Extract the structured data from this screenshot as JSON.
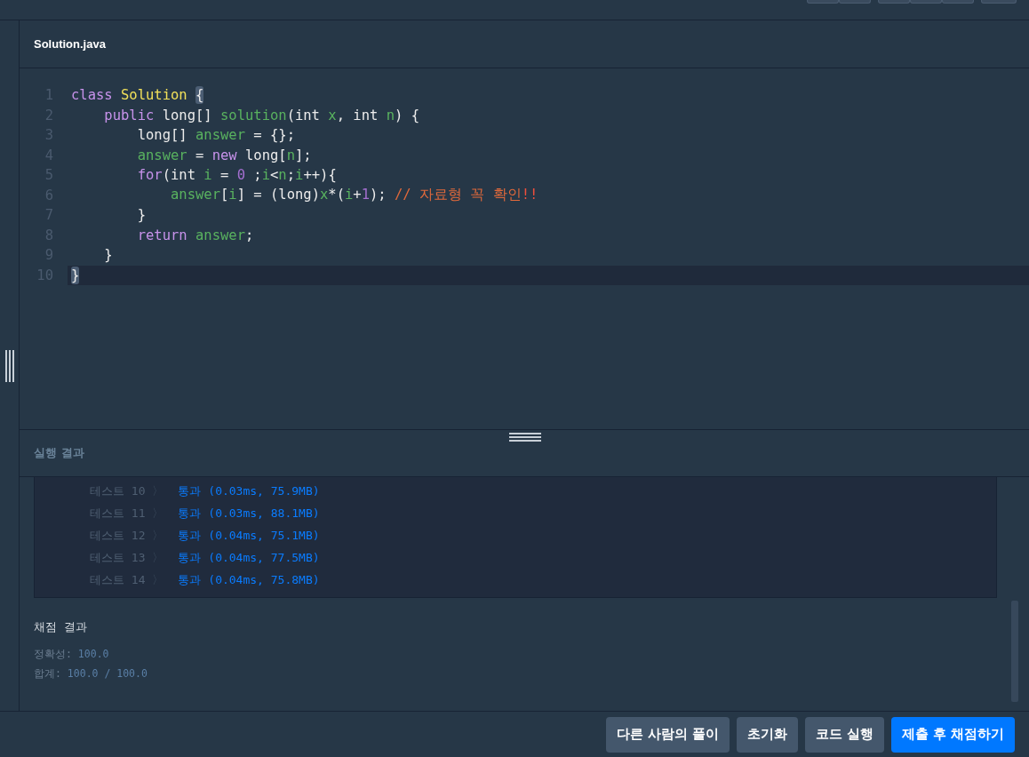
{
  "file_tab": {
    "title": "Solution.java"
  },
  "editor": {
    "lines": [
      {
        "number": "1",
        "current": false,
        "tokens": [
          {
            "t": "class ",
            "kind": "keyword"
          },
          {
            "t": "Solution ",
            "kind": "class"
          },
          {
            "t": "{",
            "kind": "match"
          }
        ],
        "children": [
          {
            "number": "2",
            "current": false,
            "tokens": [
              {
                "t": "public ",
                "kind": "keyword"
              },
              {
                "t": "long[] ",
                "kind": "plain"
              },
              {
                "t": "solution",
                "kind": "ident"
              },
              {
                "t": "(int ",
                "kind": "plain"
              },
              {
                "t": "x",
                "kind": "ident"
              },
              {
                "t": ", int ",
                "kind": "plain"
              },
              {
                "t": "n",
                "kind": "ident"
              },
              {
                "t": ") {",
                "kind": "plain"
              }
            ],
            "children": [
              {
                "number": "3",
                "current": false,
                "tokens": [
                  {
                    "t": "long[] ",
                    "kind": "plain"
                  },
                  {
                    "t": "answer",
                    "kind": "ident"
                  },
                  {
                    "t": " = {};",
                    "kind": "plain"
                  }
                ]
              },
              {
                "number": "4",
                "current": false,
                "tokens": [
                  {
                    "t": "answer",
                    "kind": "ident"
                  },
                  {
                    "t": " = ",
                    "kind": "plain"
                  },
                  {
                    "t": "new",
                    "kind": "keyword"
                  },
                  {
                    "t": " long[",
                    "kind": "plain"
                  },
                  {
                    "t": "n",
                    "kind": "ident"
                  },
                  {
                    "t": "];",
                    "kind": "plain"
                  }
                ]
              },
              {
                "number": "5",
                "current": false,
                "tokens": [
                  {
                    "t": "for",
                    "kind": "keyword"
                  },
                  {
                    "t": "(int ",
                    "kind": "plain"
                  },
                  {
                    "t": "i",
                    "kind": "ident"
                  },
                  {
                    "t": " = ",
                    "kind": "plain"
                  },
                  {
                    "t": "0",
                    "kind": "number"
                  },
                  {
                    "t": " ;",
                    "kind": "plain"
                  },
                  {
                    "t": "i",
                    "kind": "ident"
                  },
                  {
                    "t": "<",
                    "kind": "plain"
                  },
                  {
                    "t": "n",
                    "kind": "ident"
                  },
                  {
                    "t": ";",
                    "kind": "plain"
                  },
                  {
                    "t": "i",
                    "kind": "ident"
                  },
                  {
                    "t": "++){",
                    "kind": "plain"
                  }
                ],
                "children": [
                  {
                    "number": "6",
                    "current": false,
                    "tokens": [
                      {
                        "t": "answer",
                        "kind": "ident"
                      },
                      {
                        "t": "[",
                        "kind": "plain"
                      },
                      {
                        "t": "i",
                        "kind": "ident"
                      },
                      {
                        "t": "] = (long)",
                        "kind": "plain"
                      },
                      {
                        "t": "x",
                        "kind": "ident"
                      },
                      {
                        "t": "*(",
                        "kind": "plain"
                      },
                      {
                        "t": "i",
                        "kind": "ident"
                      },
                      {
                        "t": "+",
                        "kind": "plain"
                      },
                      {
                        "t": "1",
                        "kind": "number"
                      },
                      {
                        "t": "); ",
                        "kind": "plain"
                      },
                      {
                        "t": "// 자료형 꼭 확인",
                        "kind": "comment"
                      },
                      {
                        "t": "!!",
                        "kind": "bang"
                      }
                    ]
                  }
                ]
              },
              {
                "number": "7",
                "current": false,
                "tokens": [
                  {
                    "t": "}",
                    "kind": "plain"
                  }
                ]
              },
              {
                "number": "8",
                "current": false,
                "tokens": [
                  {
                    "t": "return ",
                    "kind": "keyword"
                  },
                  {
                    "t": "answer",
                    "kind": "ident"
                  },
                  {
                    "t": ";",
                    "kind": "plain"
                  }
                ]
              }
            ]
          },
          {
            "number": "9",
            "current": false,
            "tokens": [
              {
                "t": "}",
                "kind": "plain"
              }
            ]
          }
        ]
      },
      {
        "number": "10",
        "current": true,
        "tokens": [
          {
            "t": "}",
            "kind": "match"
          }
        ]
      }
    ]
  },
  "run_result": {
    "title": "실행 결과",
    "rows": [
      {
        "label": "테스트 10",
        "chevron": "〉",
        "result": "통과 (0.03ms, 75.9MB)"
      },
      {
        "label": "테스트 11",
        "chevron": "〉",
        "result": "통과 (0.03ms, 88.1MB)"
      },
      {
        "label": "테스트 12",
        "chevron": "〉",
        "result": "통과 (0.04ms, 75.1MB)"
      },
      {
        "label": "테스트 13",
        "chevron": "〉",
        "result": "통과 (0.04ms, 77.5MB)"
      },
      {
        "label": "테스트 14",
        "chevron": "〉",
        "result": "통과 (0.04ms, 75.8MB)"
      }
    ]
  },
  "grading": {
    "title": "채점 결과",
    "stats": [
      {
        "label": "정확성: ",
        "value": "100.0"
      },
      {
        "label": "합계: ",
        "value": "100.0 / 100.0"
      }
    ]
  },
  "buttons": [
    {
      "label": "다른 사람의 풀이",
      "primary": false
    },
    {
      "label": "초기화",
      "primary": false
    },
    {
      "label": "코드 실행",
      "primary": false
    },
    {
      "label": "제출 후 채점하기",
      "primary": true
    }
  ]
}
